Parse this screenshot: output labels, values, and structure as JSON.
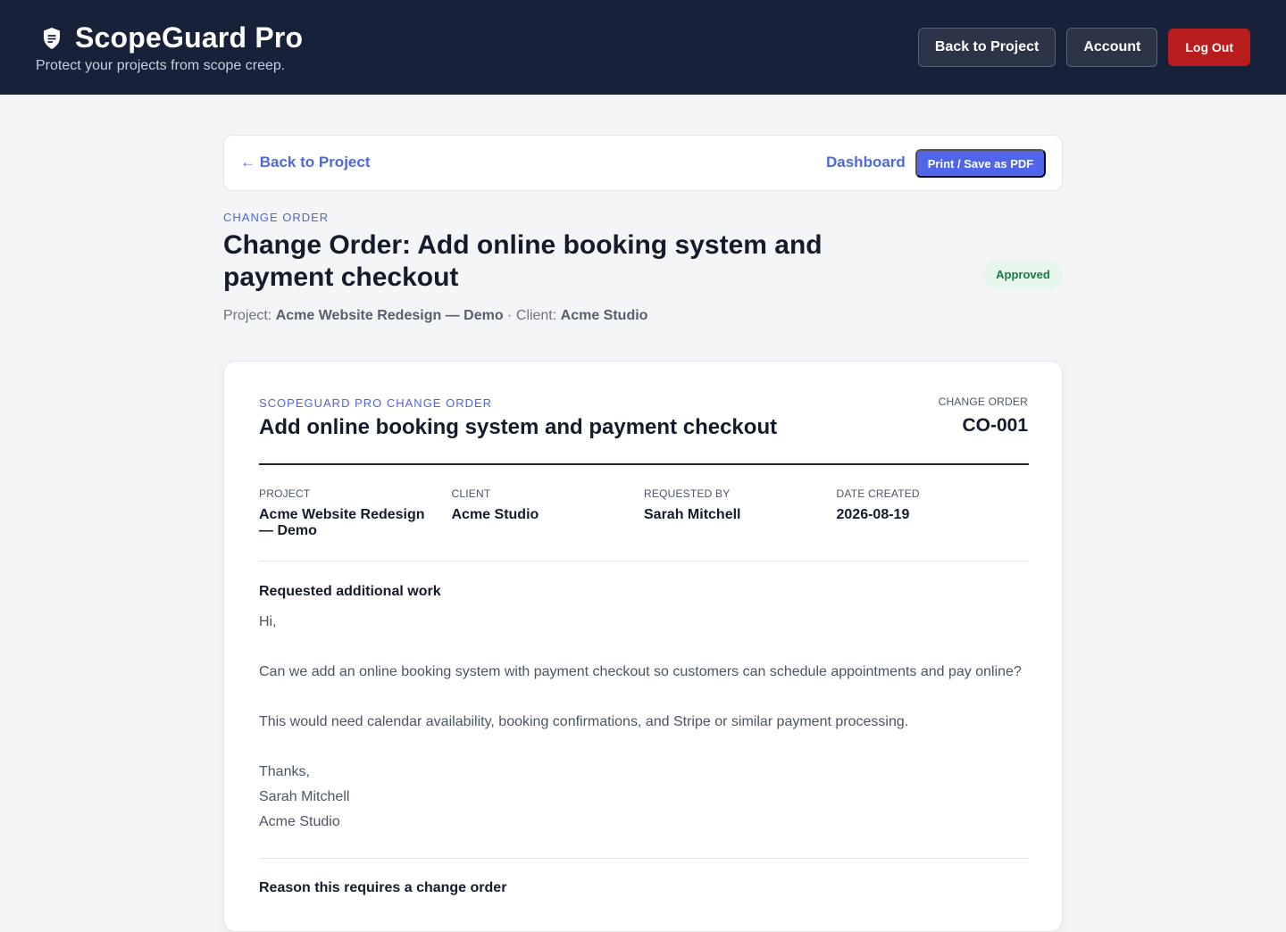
{
  "app": {
    "title": "ScopeGuard Pro",
    "tagline": "Protect your projects from scope creep.",
    "icon": "shield-check-icon"
  },
  "header": {
    "back_label": "Back to Project",
    "account_label": "Account",
    "logout_label": "Log Out"
  },
  "subnav": {
    "back_label": "← Back to Project",
    "dashboard_label": "Dashboard",
    "print_label": "Print / Save as PDF"
  },
  "page": {
    "eyebrow": "CHANGE ORDER",
    "title": "Change Order: Add online booking system and payment checkout",
    "status": "Approved",
    "project_prefix": "Project:",
    "project_name": "Acme Website Redesign — Demo",
    "separator": "·",
    "client_prefix": "Client:",
    "client_name": "Acme Studio"
  },
  "document": {
    "eyebrow": "SCOPEGUARD PRO CHANGE ORDER",
    "title": "Add online booking system and payment checkout",
    "co_label": "CHANGE ORDER",
    "co_number": "CO-001",
    "fields": [
      {
        "label": "PROJECT",
        "value": "Acme Website Redesign — Demo"
      },
      {
        "label": "CLIENT",
        "value": "Acme Studio"
      },
      {
        "label": "REQUESTED BY",
        "value": "Sarah Mitchell"
      },
      {
        "label": "DATE CREATED",
        "value": "2026-08-19"
      }
    ],
    "requested_title": "Requested additional work",
    "requested_lines": [
      "Hi,",
      "",
      "Can we add an online booking system with payment checkout so customers can schedule appointments and pay online?",
      "",
      "This would need calendar availability, booking confirmations, and Stripe or similar payment processing.",
      "",
      "Thanks,",
      "Sarah Mitchell",
      "Acme Studio"
    ],
    "reason_title": "Reason this requires a change order"
  },
  "colors": {
    "header_bg": "#18213a",
    "accent": "#5066e8",
    "danger": "#b91c1c",
    "success_bg": "#e6f6ec",
    "success_text": "#177a43"
  }
}
